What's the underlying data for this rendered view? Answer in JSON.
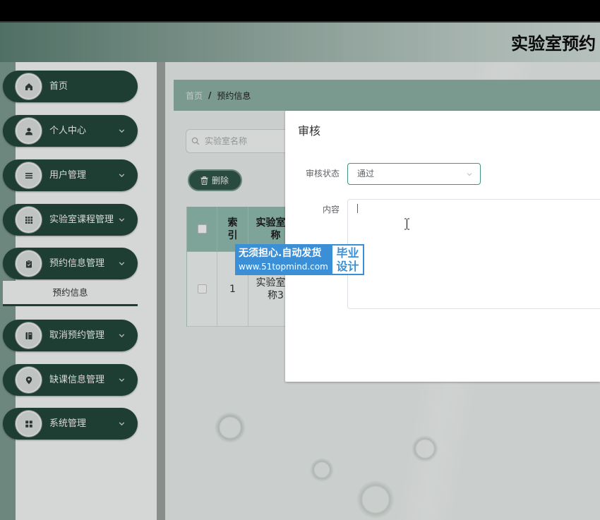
{
  "app": {
    "title": "实验室预约"
  },
  "sidebar": {
    "items": [
      {
        "label": "首页",
        "icon": "home-icon",
        "expandable": false
      },
      {
        "label": "个人中心",
        "icon": "user-icon",
        "expandable": true
      },
      {
        "label": "用户管理",
        "icon": "list-icon",
        "expandable": true
      },
      {
        "label": "实验室课程管理",
        "icon": "grid-icon",
        "expandable": true
      },
      {
        "label": "预约信息管理",
        "icon": "clipboard-icon",
        "expandable": true,
        "expanded": true,
        "children": [
          {
            "label": "预约信息",
            "active": true
          }
        ]
      },
      {
        "label": "取消预约管理",
        "icon": "book-icon",
        "expandable": true
      },
      {
        "label": "缺课信息管理",
        "icon": "location-icon",
        "expandable": true
      },
      {
        "label": "系统管理",
        "icon": "apps-icon",
        "expandable": true
      }
    ]
  },
  "breadcrumb": {
    "items": [
      "首页",
      "预约信息"
    ],
    "separator": "/"
  },
  "toolbar": {
    "search_placeholder": "实验室名称",
    "search_icon": "search-icon",
    "delete_label": "删除",
    "delete_icon": "trash-icon"
  },
  "table": {
    "columns": [
      "索引",
      "实验室名称"
    ],
    "rows": [
      {
        "checked": false,
        "index": "1",
        "name": "实验室名称3"
      }
    ]
  },
  "dialog": {
    "title": "审核",
    "status_label": "审核状态",
    "status_value": "通过",
    "content_label": "内容"
  },
  "watermark": {
    "line1": "无须担心.自动发货",
    "line2": "www.51topmind.com",
    "badge_line1": "毕业",
    "badge_line2": "设计"
  },
  "theme": {
    "primary": "#24483c",
    "breadcrumb_bg": "#91b5a9",
    "table_header_bg": "#95c1b4",
    "focus_border": "#3f9484",
    "watermark_blue": "#3b8fd6"
  }
}
